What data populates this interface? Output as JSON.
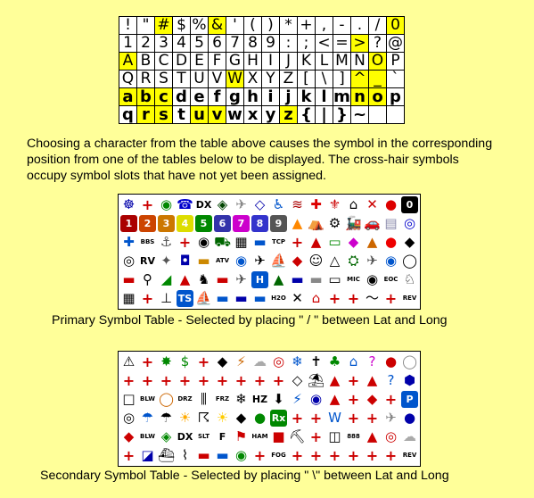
{
  "char_table": {
    "rows": [
      [
        "!",
        "\"",
        "#",
        "$",
        "%",
        "&",
        "'",
        "(",
        ")",
        "*",
        "+",
        ",",
        "-",
        ".",
        "/",
        "0"
      ],
      [
        "1",
        "2",
        "3",
        "4",
        "5",
        "6",
        "7",
        "8",
        "9",
        ":",
        ";",
        "<",
        "=",
        ">",
        "?",
        "@"
      ],
      [
        "A",
        "B",
        "C",
        "D",
        "E",
        "F",
        "G",
        "H",
        "I",
        "J",
        "K",
        "L",
        "M",
        "N",
        "O",
        "P"
      ],
      [
        "Q",
        "R",
        "S",
        "T",
        "U",
        "V",
        "W",
        "X",
        "Y",
        "Z",
        "[",
        "\\",
        "]",
        "^",
        "_",
        "`"
      ],
      [
        "a",
        "b",
        "c",
        "d",
        "e",
        "f",
        "g",
        "h",
        "i",
        "j",
        "k",
        "l",
        "m",
        "n",
        "o",
        "p"
      ],
      [
        "q",
        "r",
        "s",
        "t",
        "u",
        "v",
        "w",
        "x",
        "y",
        "z",
        "{",
        "|",
        "}",
        "~",
        "",
        ""
      ]
    ],
    "highlighted": [
      [
        0,
        2
      ],
      [
        0,
        5
      ],
      [
        0,
        15
      ],
      [
        1,
        13
      ],
      [
        2,
        0
      ],
      [
        2,
        14
      ],
      [
        3,
        6
      ],
      [
        3,
        13
      ],
      [
        3,
        14
      ],
      [
        4,
        0
      ],
      [
        4,
        1
      ],
      [
        4,
        2
      ],
      [
        4,
        13
      ],
      [
        4,
        14
      ],
      [
        5,
        1
      ],
      [
        5,
        2
      ],
      [
        5,
        4
      ],
      [
        5,
        5
      ],
      [
        5,
        9
      ]
    ]
  },
  "description": "Choosing a character from the table above causes the symbol in the corresponding position from one of the tables below to be displayed. The cross-hair symbols occupy symbol slots that have not yet been assigned.",
  "primary": {
    "caption": "Primary Symbol Table - Selected by placing \" / \" between Lat and Long",
    "rows": [
      [
        "star-of-life-icon:☸:#00a",
        "cross-hair-icon:+:x",
        "digi-icon:◉:#080",
        "phone-icon:☎:#00c",
        "dx-icon:DX:t",
        "hf-gateway-icon:◈:#040",
        "small-aircraft-icon:✈:#888",
        "mobile-sat-icon:◇:#00a",
        "wheelchair-icon:♿:#05c",
        "snowmobile-icon:≋:#a00",
        "red-cross-icon:✚:#d00",
        "boy-scouts-icon:⚜:#c00",
        "house-qth-icon:⌂:#000",
        "x-icon:✕:#c00",
        "red-dot-icon:●:#d00",
        "num-0-icon:0:#000"
      ],
      [
        "num-1-icon:1:#a00",
        "num-2-icon:2:#c40",
        "num-3-icon:3:#c70",
        "num-4-icon:4:#dd0",
        "num-5-icon:5:#080",
        "num-6-icon:6:#33a",
        "num-7-icon:7:#c0c",
        "num-8-icon:8:#33c",
        "num-9-icon:9:#555",
        "fire-icon:▲:#f80",
        "campground-icon:⛺:#060",
        "motorcycle-icon:⚙:#000",
        "railroad-icon:🚂:#000",
        "car-icon:🚗:#c00",
        "file-server-icon:▤:#88a",
        "hurricane-icon:◎:#00c"
      ],
      [
        "aid-station-icon:✚:#05c",
        "bbs-icon:BBS:t",
        "canoe-icon:⚓:#555",
        "cross-hair-icon:+:x",
        "eyeball-icon:◉:#000",
        "tractor-icon:⛟:#060",
        "grid-square-icon:▦:#000",
        "hotel-icon:▬:#05c",
        "tcp-ip-icon:TCP:t",
        "cross-hair-icon:+:x",
        "school-icon:▲:#c00",
        "pc-user-icon:▭:#080",
        "macaps-icon:◆:#c0c",
        "nts-station-icon:▲:#c60",
        "balloon-icon:●:#e00",
        "police-icon:◆:#000"
      ],
      [
        "tbd-icon:◎:#000",
        "rv-icon:RV:t",
        "shuttle-icon:✦:#555",
        "sstv-icon:◘:#00a",
        "bus-icon:▬:#c80",
        "atv-icon:ATV:t",
        "wx-service-icon:◉:#05c",
        "helicopter-icon:✈:#000",
        "yacht-icon:⛵:#05c",
        "winapri-icon:◆:#c00",
        "jogger-icon:☺:#000",
        "triangle-df-icon:△:#000",
        "pbbs-icon:⛭:#060",
        "large-aircraft-icon:✈:#555",
        "weather-station-icon:◉:#05c",
        "dish-antenna-icon:◯:#000"
      ],
      [
        "ambulance-icon:▬:#c00",
        "bike-icon:⚲:#000",
        "incident-icon:◢:#080",
        "fire-dept-icon:▲:#c00",
        "horse-icon:♞:#000",
        "fire-truck-icon:▬:#c00",
        "glider-icon:✈:#555",
        "hospital-icon:H:#05c",
        "iota-icon:▲:#060",
        "jeep-icon:▬:#00a",
        "truck-icon:▬:#888",
        "laptop-icon:▭:#000",
        "mic-e-icon:MIC:t",
        "node-icon:◉:#000",
        "eoc-icon:EOC:t",
        "dog-icon:♘:#000"
      ],
      [
        "grid-icon:▦:#000",
        "cross-hair-icon:+:x",
        "antenna-icon:⊥:#000",
        "ts-icon:TS:#05c",
        "ship-icon:⛵:#05c",
        "truck-stop-icon:▬:#05c",
        "semi-truck-icon:▬:#00a",
        "van-icon:▬:#05c",
        "water-station-icon:H2O:t",
        "x-aprs-icon:✕:#000",
        "house-icon:⌂:#c00",
        "cross-hair-icon:+:x",
        "cross-hair-icon:+:x",
        "tilde-icon:〜:#000",
        "cross-hair-icon:+:x",
        "rev-h-icon:REV:t"
      ]
    ]
  },
  "secondary": {
    "caption": "Secondary Symbol Table  - Selected by placing  \" \\\" between Lat and Long",
    "rows": [
      [
        "emergency-icon:⚠:#000",
        "cross-hair-icon:+:x",
        "star-icon:✸:#080",
        "bank-icon:$:#080",
        "cross-hair-icon:+:x",
        "diamond-icon:◆:#000",
        "crash-site-icon:⚡:#c60",
        "cloudy-icon:☁:#aaa",
        "firenet-icon:◎:#c00",
        "snow-icon:❄:#05c",
        "church-icon:✝:#000",
        "girl-scouts-icon:♣:#080",
        "house-hf-icon:⌂:#05c",
        "unknown-icon:?:#c0c",
        "red-dot-icon:●:#c00",
        "circle-icon:◯:#888"
      ],
      [
        "cross-hair-icon:+:x",
        "cross-hair-icon:+:x",
        "cross-hair-icon:+:x",
        "cross-hair-icon:+:x",
        "cross-hair-icon:+:x",
        "cross-hair-icon:+:x",
        "cross-hair-icon:+:x",
        "cross-hair-icon:+:x",
        "cross-hair-icon:+:x",
        "gale-icon:◇:#000",
        "picnic-icon:⛱:#000",
        "advisory-icon:▲:#c00",
        "cross-hair-icon:+:x",
        "rocket-icon:▲:#c00",
        "question-icon:?:#05c",
        "hazard-icon:⬢:#00a"
      ],
      [
        "square-icon:□:#000",
        "blowing-snow-icon:BLW:t",
        "coast-guard-icon:◯:#c60",
        "drizzle-icon:DRZ:t",
        "smoke-icon:⫼:#000",
        "freezing-rain-icon:FRZ:t",
        "snow-shower-icon:❄:#000",
        "haze-icon:HZ:t",
        "rain-shower-icon:⬇:#000",
        "lightning-icon:⚡:#05c",
        "kenwood-icon:◉:#00a",
        "lighthouse-icon:▲:#c00",
        "cross-hair-icon:+:x",
        "nav-buoy-icon:◆:#c00",
        "cross-hair-icon:+:x",
        "parking-icon:P:#05c"
      ],
      [
        "quake-icon:◎:#000",
        "rain-icon:☂:#05c",
        "restaurant-icon:☂:#000",
        "sat-pacsat-icon:☀:#fa0",
        "thunderstorm-icon:☈:#000",
        "sunny-icon:☀:#fc0",
        "vortac-icon:◆:#000",
        "green-dot-icon:●:#080",
        "pharmacy-icon:Rx:#080",
        "cross-hair-icon:+:x",
        "cross-hair-icon:+:x",
        "wall-cloud-icon:W:#05c",
        "cross-hair-icon:+:x",
        "cross-hair-icon:+:x",
        "aircraft-icon:✈:#888",
        "wx-stn-icon:●:#00a"
      ],
      [
        "diamond-red-icon:◆:#c00",
        "blowing-dust-icon:BLW:t",
        "civil-defense-icon:◈:#080",
        "dx-spot-icon:DX:t",
        "sleet-icon:SLT:t",
        "funnel-cloud-icon:F:t",
        "gale-flags-icon:⚑:#c00",
        "ham-store-icon:HAM:t",
        "indoor-icon:■:#c00",
        "work-zone-icon:⛏:#000",
        "cross-hair-icon:+:x",
        "area-icon:◫:#000",
        "value-sig-icon:888:t",
        "triangle-red-icon:▲:#c00",
        "small-circle-icon:◎:#c00",
        "partly-cloudy-icon:☁:#aaa"
      ],
      [
        "cross-hair-icon:+:x",
        "restrooms-icon:◪:#00a",
        "ship-icon:⛴:#000",
        "tornado-icon:⌇:#000",
        "truck-icon:▬:#c00",
        "van-icon:▬:#05c",
        "flooding-icon:◉:#080",
        "cross-hair-icon:+:x",
        "fog-icon:FOG:t",
        "cross-hair-icon:+:x",
        "cross-hair-icon:+:x",
        "cross-hair-icon:+:x",
        "cross-hair-icon:+:x",
        "cross-hair-icon:+:x",
        "cross-hair-icon:+:x",
        "rev-h-icon:REV:t"
      ]
    ]
  }
}
